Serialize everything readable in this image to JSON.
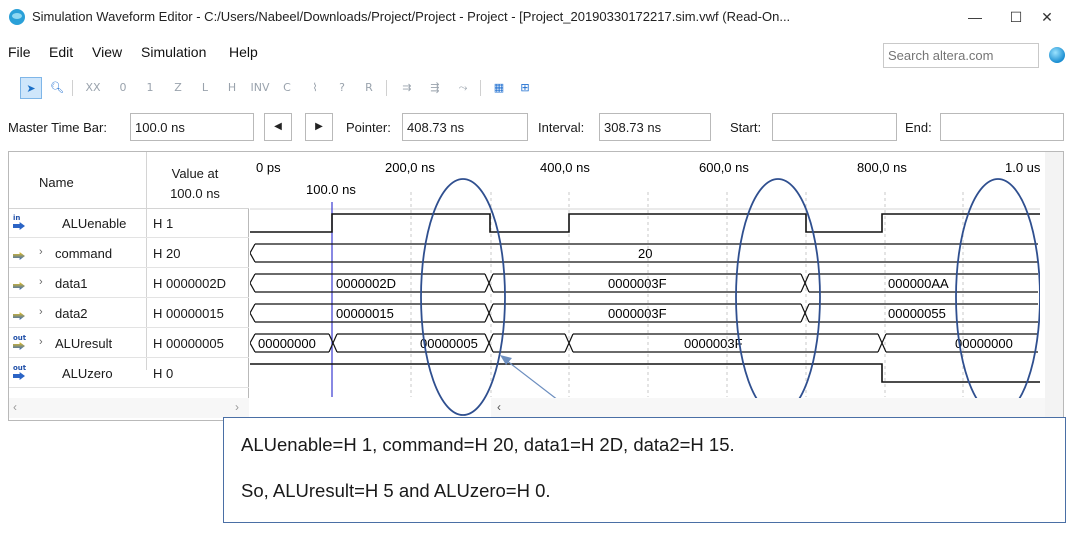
{
  "window": {
    "title": "Simulation Waveform Editor - C:/Users/Nabeel/Downloads/Project/Project - Project - [Project_20190330172217.sim.vwf (Read-On...",
    "minimize": "—",
    "maximize": "☐",
    "close": "✕"
  },
  "menu": [
    "File",
    "Edit",
    "View",
    "Simulation",
    "Help"
  ],
  "search": {
    "placeholder": "Search altera.com"
  },
  "toolbar": {
    "icons": [
      "pointer-tool-icon",
      "zoom-tool-icon",
      "forcing-unknown-icon",
      "forcing-low-icon",
      "forcing-high-icon",
      "high-impedance-icon",
      "weak-low-icon",
      "weak-high-icon",
      "invert-icon",
      "count-value-icon",
      "clock-icon",
      "random-value-icon",
      "arbitrary-value-icon",
      "snap-to-grid-icon",
      "grid-size-icon",
      "run-functional-simulation-icon",
      "run-timing-simulation-icon",
      "generate-netlist-icon",
      "open-report-icon",
      "group-icon"
    ]
  },
  "timebar": {
    "master_label": "Master Time Bar:",
    "master_value": "100.0 ns",
    "pointer_label": "Pointer:",
    "pointer_value": "408.73 ns",
    "interval_label": "Interval:",
    "interval_value": "308.73 ns",
    "start_label": "Start:",
    "start_value": "",
    "end_label": "End:",
    "end_value": ""
  },
  "grid": {
    "col_name": "Name",
    "col_value": "Value at\n100.0 ns",
    "ticks": [
      "0 ps",
      "200,0 ns",
      "400,0 ns",
      "600,0 ns",
      "800,0 ns",
      "1.0 us"
    ],
    "marker_label": "100.0 ns",
    "signals": [
      {
        "name": "ALUenable",
        "value": "H 1",
        "dir": "in",
        "expandable": false
      },
      {
        "name": "command",
        "value": "H 20",
        "dir": "in",
        "expandable": true
      },
      {
        "name": "data1",
        "value": "H 0000002D",
        "dir": "in",
        "expandable": true
      },
      {
        "name": "data2",
        "value": "H 00000015",
        "dir": "in",
        "expandable": true
      },
      {
        "name": "ALUresult",
        "value": "H 00000005",
        "dir": "out",
        "expandable": true
      },
      {
        "name": "ALUzero",
        "value": "H 0",
        "dir": "out",
        "expandable": false
      }
    ],
    "bus_labels": {
      "command": [
        "20"
      ],
      "data1": [
        "0000002D",
        "0000003F",
        "000000AA"
      ],
      "data2": [
        "00000015",
        "0000003F",
        "00000055"
      ],
      "aluresult": [
        "00000000",
        "00000005",
        "0000003F",
        "00000000"
      ]
    }
  },
  "annotation": {
    "line1": "ALUenable=H 1, command=H 20, data1=H 2D, data2=H 15.",
    "line2": "So, ALUresult=H 5 and ALUzero=H 0."
  },
  "colors": {
    "wave": "#1a1a1a",
    "highlight_ellipse": "#2f4f8f",
    "marker": "#3a3ad0",
    "selected_tool": "#cfe6fb"
  }
}
